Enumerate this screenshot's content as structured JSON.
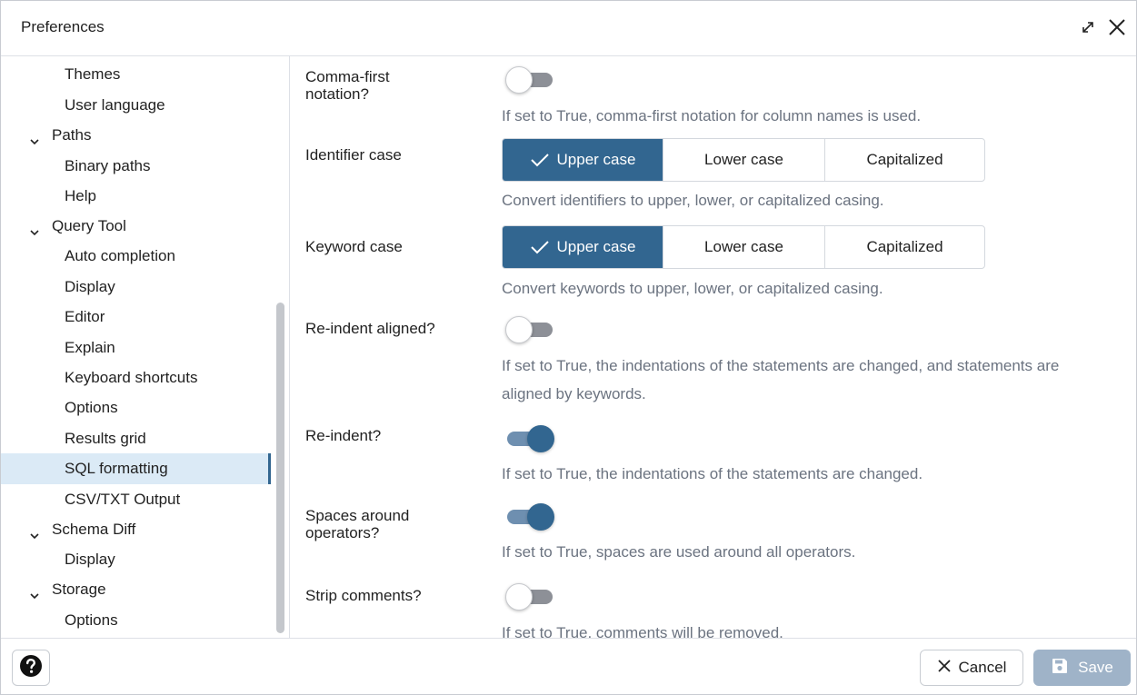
{
  "window": {
    "title": "Preferences"
  },
  "sidebar": {
    "items": [
      {
        "label": "Themes",
        "level": 1
      },
      {
        "label": "User language",
        "level": 1
      },
      {
        "label": "Paths",
        "level": 0
      },
      {
        "label": "Binary paths",
        "level": 1
      },
      {
        "label": "Help",
        "level": 1
      },
      {
        "label": "Query Tool",
        "level": 0
      },
      {
        "label": "Auto completion",
        "level": 1
      },
      {
        "label": "Display",
        "level": 1
      },
      {
        "label": "Editor",
        "level": 1
      },
      {
        "label": "Explain",
        "level": 1
      },
      {
        "label": "Keyboard shortcuts",
        "level": 1
      },
      {
        "label": "Options",
        "level": 1
      },
      {
        "label": "Results grid",
        "level": 1
      },
      {
        "label": "SQL formatting",
        "level": 1,
        "selected": true
      },
      {
        "label": "CSV/TXT Output",
        "level": 1
      },
      {
        "label": "Schema Diff",
        "level": 0
      },
      {
        "label": "Display",
        "level": 1
      },
      {
        "label": "Storage",
        "level": 0
      },
      {
        "label": "Options",
        "level": 1
      }
    ]
  },
  "settings": {
    "comma_first": {
      "label": "Comma-first notation?",
      "enabled": false,
      "help": "If set to True, comma-first notation for column names is used."
    },
    "identifier_case": {
      "label": "Identifier case",
      "options": [
        "Upper case",
        "Lower case",
        "Capitalized"
      ],
      "selected": "Upper case",
      "help": "Convert identifiers to upper, lower, or capitalized casing."
    },
    "keyword_case": {
      "label": "Keyword case",
      "options": [
        "Upper case",
        "Lower case",
        "Capitalized"
      ],
      "selected": "Upper case",
      "help": "Convert keywords to upper, lower, or capitalized casing."
    },
    "reindent_aligned": {
      "label": "Re-indent aligned?",
      "enabled": false,
      "help": "If set to True, the indentations of the statements are changed, and statements are aligned by keywords."
    },
    "reindent": {
      "label": "Re-indent?",
      "enabled": true,
      "help": "If set to True, the indentations of the statements are changed."
    },
    "spaces_around_operators": {
      "label": "Spaces around operators?",
      "enabled": true,
      "help": "If set to True, spaces are used around all operators."
    },
    "strip_comments": {
      "label": "Strip comments?",
      "enabled": false,
      "help": "If set to True, comments will be removed."
    }
  },
  "footer": {
    "cancel_label": "Cancel",
    "save_label": "Save"
  },
  "colors": {
    "accent": "#326690",
    "selected_item_bg": "#dbeaf6",
    "save_disabled": "#9fb3c8"
  },
  "icons": {
    "maximize": "expand-arrows-icon",
    "close": "close-icon",
    "help": "question-circle-icon",
    "cancel": "close-icon",
    "save": "floppy-disk-icon",
    "tree_expand": "chevron-down-icon",
    "option_selected": "check-icon"
  }
}
